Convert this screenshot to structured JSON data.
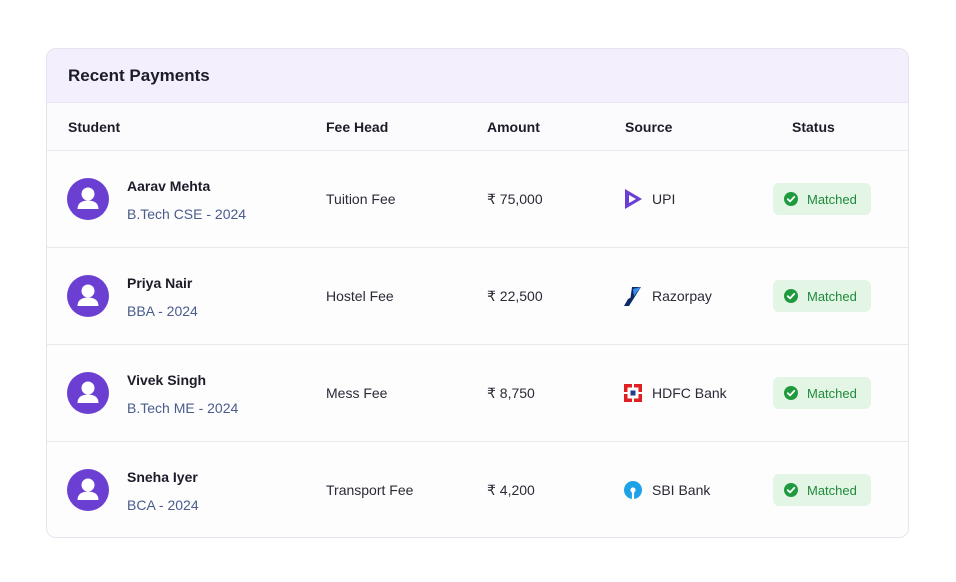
{
  "title": "Recent Payments",
  "columns": {
    "student": "Student",
    "fee_head": "Fee Head",
    "amount": "Amount",
    "source": "Source",
    "status": "Status"
  },
  "rows": [
    {
      "name": "Aarav Mehta",
      "program": "B.Tech CSE - 2024",
      "fee_head": "Tuition Fee",
      "amount": "₹ 75,000",
      "source": "UPI",
      "source_icon": "upi-icon",
      "status": "Matched"
    },
    {
      "name": "Priya Nair",
      "program": "BBA - 2024",
      "fee_head": "Hostel Fee",
      "amount": "₹ 22,500",
      "source": "Razorpay",
      "source_icon": "razorpay-icon",
      "status": "Matched"
    },
    {
      "name": "Vivek Singh",
      "program": "B.Tech ME - 2024",
      "fee_head": "Mess Fee",
      "amount": "₹ 8,750",
      "source": "HDFC Bank",
      "source_icon": "hdfc-bank-icon",
      "status": "Matched"
    },
    {
      "name": "Sneha Iyer",
      "program": "BCA - 2024",
      "fee_head": "Transport Fee",
      "amount": "₹ 4,200",
      "source": "SBI Bank",
      "source_icon": "sbi-bank-icon",
      "status": "Matched"
    }
  ],
  "colors": {
    "avatar": "#6b3fd1",
    "header_bg": "#f4effd",
    "badge_bg": "#e3f5e5",
    "badge_text": "#1f8a3a",
    "program_text": "#4a5b8c"
  }
}
